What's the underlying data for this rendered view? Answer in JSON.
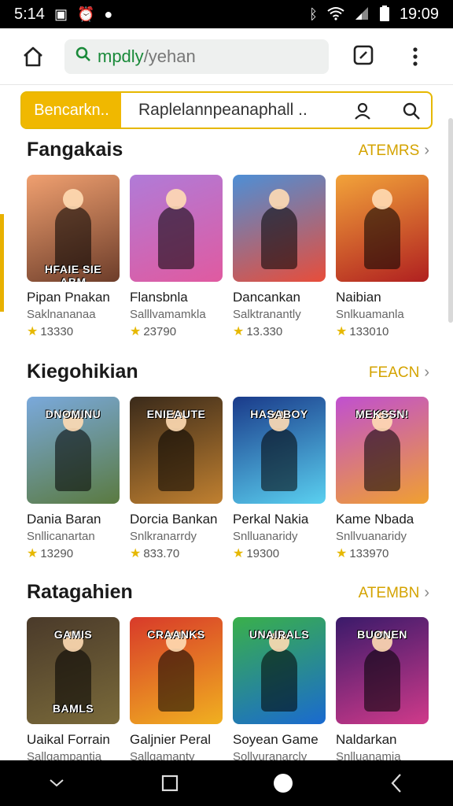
{
  "status": {
    "left_time": "5:14",
    "right_time": "19:09"
  },
  "toolbar": {
    "url_host": "mpdly",
    "url_path": "/yehan"
  },
  "search": {
    "tag": "Bencarkn..",
    "value": "Raplelannpeanaphall .."
  },
  "sections": [
    {
      "title": "Fangakais",
      "more": "ATEMRS",
      "cards": [
        {
          "art": "HFAIE SIE ABM",
          "title": "Pipan Pnakan",
          "sub": "Saklnananaa",
          "rating": "13330",
          "colors": [
            "#f0a070",
            "#6d3d2a"
          ]
        },
        {
          "art": "",
          "title": "Flansbnla",
          "sub": "Salllvamamkla",
          "rating": "23790",
          "colors": [
            "#b07bd8",
            "#e05aa0"
          ]
        },
        {
          "art": "",
          "title": "Dancankan",
          "sub": "Salktranantly",
          "rating": "13.330",
          "colors": [
            "#4d8fd6",
            "#e84d3a"
          ]
        },
        {
          "art": "",
          "title": "Naibian",
          "sub": "Snlkuamanla",
          "rating": "133010",
          "colors": [
            "#f2a33a",
            "#b02020"
          ]
        }
      ]
    },
    {
      "title": "Kiegohikian",
      "more": "FEACN",
      "cards": [
        {
          "art": "DNOMINU",
          "title": "Dania Baran",
          "sub": "Snllicanartan",
          "rating": "13290",
          "colors": [
            "#7aa9dc",
            "#5a7a40"
          ]
        },
        {
          "art": "ENIEAUTE",
          "title": "Dorcia Bankan",
          "sub": "Snlkranarrdy",
          "rating": "833.70",
          "colors": [
            "#3a2a1a",
            "#c08030"
          ]
        },
        {
          "art": "HASABOY",
          "title": "Perkal Nakia",
          "sub": "Snlluanaridy",
          "rating": "19300",
          "colors": [
            "#1a3a8a",
            "#5ad0f0"
          ]
        },
        {
          "art": "MEKSSN!",
          "title": "Kame Nbada",
          "sub": "Snllvuanaridy",
          "rating": "133970",
          "colors": [
            "#c050d0",
            "#f0a030"
          ]
        }
      ]
    },
    {
      "title": "Ratagahien",
      "more": "ATEMBN",
      "cards": [
        {
          "art": "GAMIS",
          "art2": "BAMLS",
          "title": "Uaikal Forrain",
          "sub": "Sallgampantia",
          "rating": "",
          "colors": [
            "#4a3a2a",
            "#7a6a3a"
          ]
        },
        {
          "art": "CRAANKS",
          "title": "Galjnier Peral",
          "sub": "Sallgamanty",
          "rating": "",
          "colors": [
            "#d83a2a",
            "#f0b020"
          ]
        },
        {
          "art": "UNAIRALS",
          "title": "Soyean Game",
          "sub": "Sollvuranarcly",
          "rating": "",
          "colors": [
            "#3ab04a",
            "#1a6ad0"
          ]
        },
        {
          "art": "BUONEN",
          "title": "Naldarkan",
          "sub": "Snlluanamia",
          "rating": "",
          "colors": [
            "#3a1a6a",
            "#d03a8a"
          ]
        }
      ]
    }
  ]
}
